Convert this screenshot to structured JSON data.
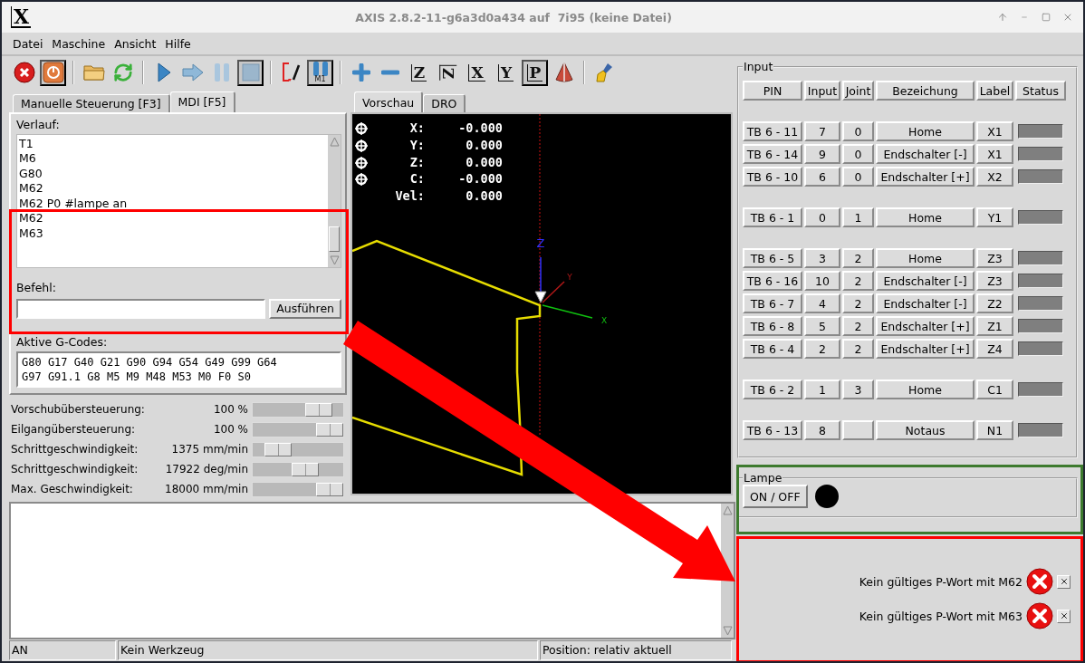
{
  "window": {
    "logo": "X",
    "title": "AXIS 2.8.2-11-g6a3d0a434 auf  7i95 (keine Datei)"
  },
  "menu": [
    "Datei",
    "Maschine",
    "Ansicht",
    "Hilfe"
  ],
  "toolbar": [
    {
      "kind": "estop",
      "pressed": false
    },
    {
      "kind": "power",
      "pressed": true
    },
    {
      "kind": "separator"
    },
    {
      "kind": "open",
      "pressed": false
    },
    {
      "kind": "reload",
      "pressed": false
    },
    {
      "kind": "separator"
    },
    {
      "kind": "run",
      "pressed": false
    },
    {
      "kind": "step",
      "pressed": false
    },
    {
      "kind": "pause",
      "pressed": false
    },
    {
      "kind": "stop",
      "pressed": true
    },
    {
      "kind": "separator"
    },
    {
      "kind": "block-delete",
      "pressed": false
    },
    {
      "kind": "optional-stop",
      "label": "M1",
      "pressed": true
    },
    {
      "kind": "separator"
    },
    {
      "kind": "zoom-in",
      "pressed": false
    },
    {
      "kind": "zoom-out",
      "pressed": false
    },
    {
      "kind": "view",
      "label": "Z",
      "pressed": false
    },
    {
      "kind": "view-rotated",
      "label": "Z",
      "pressed": false
    },
    {
      "kind": "view",
      "label": "X",
      "pressed": false
    },
    {
      "kind": "view",
      "label": "Y",
      "pressed": false
    },
    {
      "kind": "view",
      "label": "P",
      "pressed": true
    },
    {
      "kind": "clear",
      "pressed": false
    },
    {
      "kind": "separator"
    },
    {
      "kind": "brush",
      "pressed": false
    }
  ],
  "control_tabs": [
    {
      "label": "Manuelle Steuerung [F3]",
      "selected": false
    },
    {
      "label": "MDI [F5]",
      "selected": true
    }
  ],
  "mdi": {
    "history_label": "Verlauf:",
    "history": [
      "T1",
      "M6",
      "G80",
      "M62",
      "M62 P0 #lampe an",
      "M62",
      "M63"
    ],
    "command_label": "Befehl:",
    "run_button": "Ausführen",
    "gcodes_label": "Aktive G-Codes:",
    "gcodes": [
      "G80 G17 G40 G21 G90 G94 G54 G49 G99 G64",
      "G97 G91.1 G8 M5 M9 M48 M53 M0 F0 S0"
    ]
  },
  "overrides": [
    {
      "label": "Vorschubübersteuerung:",
      "reading": "100 %",
      "level": 0.83
    },
    {
      "label": "Eilgangübersteuerung:",
      "reading": "100 %",
      "level": 1
    },
    {
      "label": "Schrittgeschwindigkeit:",
      "reading": "1375 mm/min",
      "level": 0.19
    },
    {
      "label": "Schrittgeschwindigkeit:",
      "reading": "17922 deg/min",
      "level": 0.61
    },
    {
      "label": "Max. Geschwindigkeit:",
      "reading": "18000 mm/min",
      "level": 1
    }
  ],
  "preview_tabs": [
    {
      "label": "Vorschau",
      "selected": true
    },
    {
      "label": "DRO",
      "selected": false
    }
  ],
  "dro": [
    {
      "axis": "X:",
      "value": "-0.000",
      "homed": true
    },
    {
      "axis": "Y:",
      "value": "0.000",
      "homed": true
    },
    {
      "axis": "Z:",
      "value": "0.000",
      "homed": true
    },
    {
      "axis": "C:",
      "value": "-0.000",
      "homed": true
    },
    {
      "axis": "Vel:",
      "value": "0.000"
    }
  ],
  "axes": [
    "Z",
    "Y",
    "X"
  ],
  "status_bar": [
    "AN",
    "Kein Werkzeug",
    "Position: relativ aktuell"
  ],
  "input_panel": {
    "title": "Input",
    "columns": [
      "PIN",
      "Input",
      "Joint",
      "Bezeichung",
      "Label",
      "Status"
    ],
    "groups": [
      [
        {
          "pin": "TB 6 - 11",
          "input": "7",
          "joint": "0",
          "name": "Home",
          "label": "X1",
          "active": false
        },
        {
          "pin": "TB 6 - 14",
          "input": "9",
          "joint": "0",
          "name": "Endschalter [-]",
          "label": "X1",
          "active": false
        },
        {
          "pin": "TB 6 - 10",
          "input": "6",
          "joint": "0",
          "name": "Endschalter [+]",
          "label": "X2",
          "active": false
        }
      ],
      [
        {
          "pin": "TB 6 - 1",
          "input": "0",
          "joint": "1",
          "name": "Home",
          "label": "Y1",
          "active": false
        }
      ],
      [
        {
          "pin": "TB 6 - 5",
          "input": "3",
          "joint": "2",
          "name": "Home",
          "label": "Z3",
          "active": false
        },
        {
          "pin": "TB 6 - 16",
          "input": "10",
          "joint": "2",
          "name": "Endschalter [-]",
          "label": "Z3",
          "active": false
        },
        {
          "pin": "TB 6 - 7",
          "input": "4",
          "joint": "2",
          "name": "Endschalter [-]",
          "label": "Z2",
          "active": false
        },
        {
          "pin": "TB 6 - 8",
          "input": "5",
          "joint": "2",
          "name": "Endschalter [+]",
          "label": "Z1",
          "active": false
        },
        {
          "pin": "TB 6 - 4",
          "input": "2",
          "joint": "2",
          "name": "Endschalter [+]",
          "label": "Z4",
          "active": false
        }
      ],
      [
        {
          "pin": "TB 6 - 2",
          "input": "1",
          "joint": "3",
          "name": "Home",
          "label": "C1",
          "active": false
        }
      ],
      [
        {
          "pin": "TB 6 - 13",
          "input": "8",
          "name": "Notaus",
          "label": "N1",
          "active": false
        }
      ]
    ]
  },
  "lamp": {
    "title": "Lampe",
    "button": "ON / OFF",
    "on": false
  },
  "notifications": [
    {
      "text": "Kein gültiges P-Wort mit M62"
    },
    {
      "text": "Kein gültiges P-Wort mit M63"
    }
  ],
  "annotations": [
    {
      "kind": "box",
      "color": "#ff0000"
    },
    {
      "kind": "arrow",
      "color": "#ff0000"
    },
    {
      "kind": "box",
      "color": "#3d7a2e"
    },
    {
      "kind": "box",
      "color": "#ff0000"
    }
  ]
}
